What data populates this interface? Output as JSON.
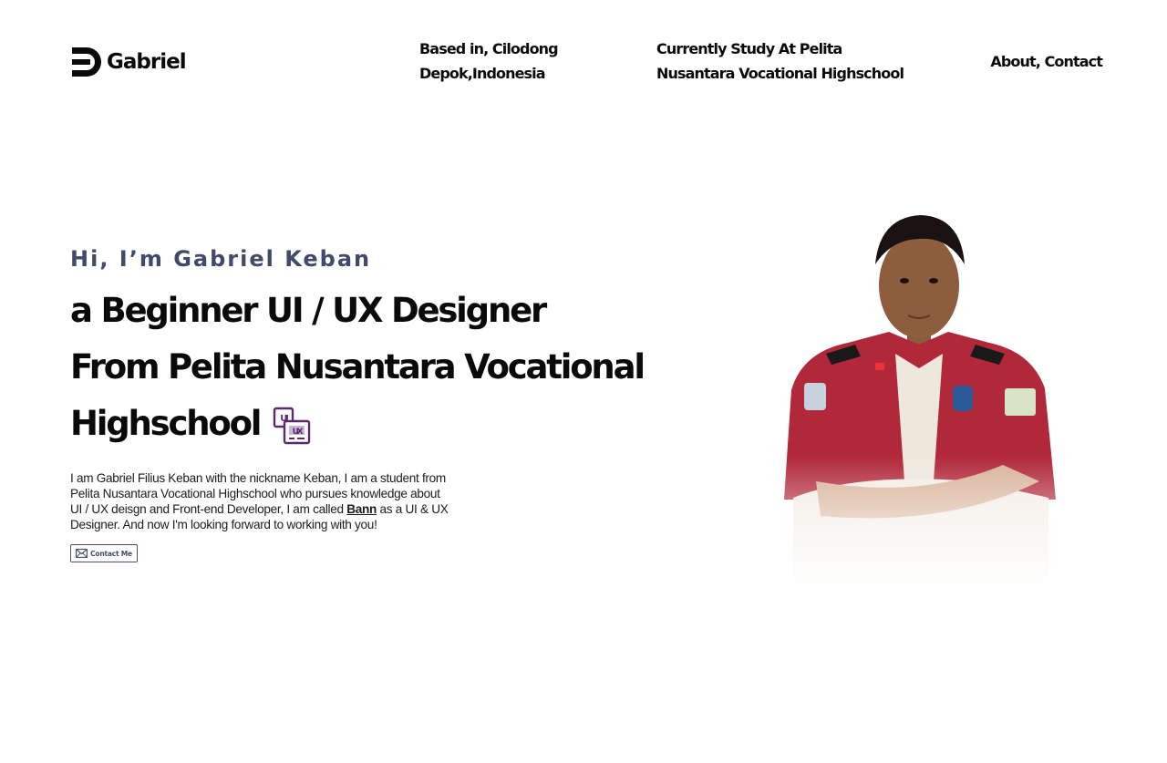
{
  "header": {
    "logo_text": "Gabriel",
    "location_line1": "Based in, Cilodong",
    "location_line2": "Depok,Indonesia",
    "study_line1": "Currently Study At Pelita",
    "study_line2": "Nusantara Vocational Highschool",
    "nav_about": "About",
    "nav_separator": ", ",
    "nav_contact": "Contact"
  },
  "hero": {
    "greeting": "Hi, I’m Gabriel Keban",
    "headline_line1": "a Beginner UI / UX Designer",
    "headline_line2": "From Pelita Nusantara Vocational",
    "headline_line3": "Highschool",
    "icon_label_top": "UI",
    "icon_label_bottom": "UX",
    "desc_part1": "I am Gabriel Filius Keban with the nickname Keban, I am a student from Pelita Nusantara Vocational Highschool who pursues knowledge about UI / UX deisgn and Front-end Developer, I am called ",
    "desc_nickname": "Bann",
    "desc_part2": " as a UI & UX Designer. And now I'm looking forward to working with you!",
    "contact_button": "Contact Me"
  },
  "colors": {
    "accent": "#414a6b",
    "text": "#0a0a0a",
    "icon_purple": "#5a2a6e",
    "shirt_red": "#b1283a"
  }
}
